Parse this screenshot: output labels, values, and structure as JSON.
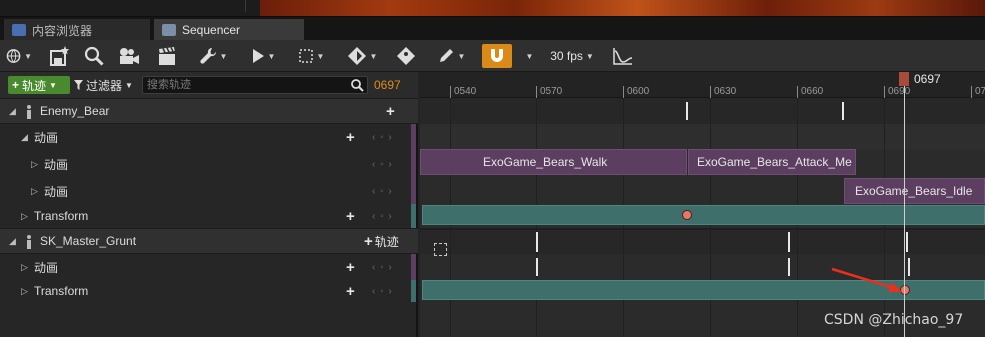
{
  "tabs": [
    {
      "label": "内容浏览器",
      "icon": "content-browser-icon"
    },
    {
      "label": "Sequencer",
      "icon": "sequencer-icon"
    }
  ],
  "toolbar": {
    "fps_label": "30 fps"
  },
  "left_panel": {
    "add_track_label": "轨迹",
    "filter_label": "过滤器",
    "search_placeholder": "搜索轨迹",
    "current_frame": "0697",
    "rows": [
      {
        "label": "Enemy_Bear",
        "type": "actor"
      },
      {
        "label": "动画",
        "type": "track"
      },
      {
        "label": "动画",
        "type": "subtrack"
      },
      {
        "label": "动画",
        "type": "subtrack"
      },
      {
        "label": "Transform",
        "type": "track"
      },
      {
        "label": "SK_Master_Grunt",
        "type": "actor",
        "add_track_label": "轨迹"
      },
      {
        "label": "动画",
        "type": "track"
      },
      {
        "label": "Transform",
        "type": "track"
      }
    ]
  },
  "timeline": {
    "ruler_labels": [
      "0540",
      "0570",
      "0600",
      "0630",
      "0660",
      "0690",
      "07"
    ],
    "playhead_label": "0697",
    "clips": [
      {
        "label": "ExoGame_Bears_Walk"
      },
      {
        "label": "ExoGame_Bears_Attack_Me"
      },
      {
        "label": "ExoGame_Bears_Idle"
      }
    ]
  },
  "watermark": "CSDN @Zhichao_97",
  "colors": {
    "accent_orange": "#e08a1a",
    "add_green": "#4a8a2e",
    "clip_purple": "#5b3e60",
    "transform_teal": "#3e6f6b",
    "key_red": "#e07a6b"
  }
}
